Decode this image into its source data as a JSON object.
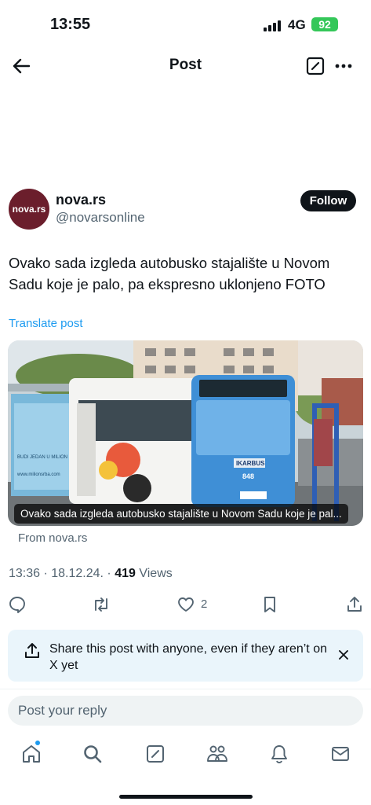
{
  "status": {
    "time": "13:55",
    "network": "4G",
    "battery": "92"
  },
  "nav": {
    "title": "Post"
  },
  "author": {
    "avatar_text": "nova.rs",
    "name": "nova.rs",
    "handle": "@novarsonline",
    "follow_label": "Follow"
  },
  "post": {
    "text": "Ovako sada izgleda autobusko stajalište u Novom Sadu koje je palo, pa ekspresno uklonjeno FOTO",
    "translate_label": "Translate post",
    "card_caption": "Ovako sada izgleda autobusko stajalište u Novom Sadu koje je pal...",
    "card_source": "From nova.rs",
    "card_image": {
      "bus_brand": "IKARBUS",
      "bus_number": "848",
      "ad_text": "BUDI JEDAN U MILION",
      "ad_url": "www.milionsrba.com"
    },
    "meta_prefix": "13:36 · 18.12.24. · ",
    "views_count": "419",
    "views_label": " Views",
    "likes": "2"
  },
  "share_banner": {
    "text": "Share this post with anyone, even if they aren’t on X yet"
  },
  "reply": {
    "placeholder": "Post your reply"
  },
  "icons": {
    "back": "back-arrow-icon",
    "compose": "compose-icon",
    "more": "more-icon",
    "reply": "reply-icon",
    "repost": "repost-icon",
    "like": "heart-icon",
    "bookmark": "bookmark-icon",
    "share": "share-icon",
    "tabs": [
      "home-icon",
      "search-icon",
      "compose-icon",
      "communities-icon",
      "notifications-icon",
      "messages-icon"
    ]
  },
  "colors": {
    "accent": "#1d9bf0",
    "text": "#0f1419",
    "muted": "#536471",
    "banner": "#eaf5fb",
    "battery": "#34c759",
    "avatar": "#6b1e2c"
  }
}
